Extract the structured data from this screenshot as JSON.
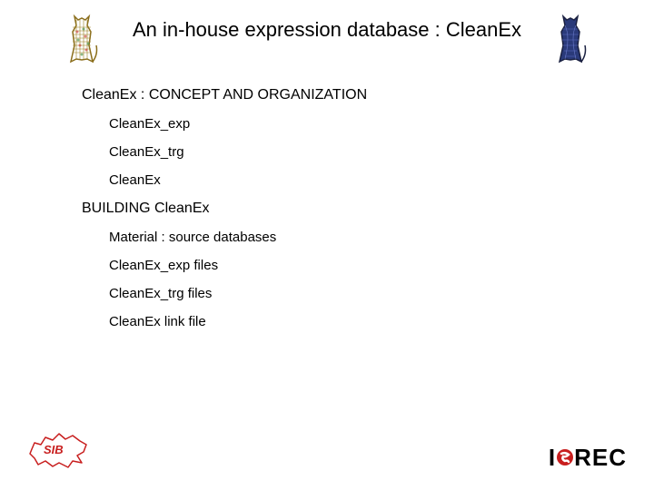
{
  "title": "An in-house expression database : CleanEx",
  "sections": [
    {
      "heading": "CleanEx  : CONCEPT AND ORGANIZATION",
      "items": [
        "CleanEx_exp",
        "CleanEx_trg",
        "CleanEx"
      ]
    },
    {
      "heading": "BUILDING CleanEx",
      "items": [
        "Material : source databases",
        "CleanEx_exp files",
        "CleanEx_trg files",
        "CleanEx link file"
      ]
    }
  ],
  "logos": {
    "sib": "SIB",
    "isrec_i": "I",
    "isrec_s": "S",
    "isrec_rec": "REC"
  }
}
